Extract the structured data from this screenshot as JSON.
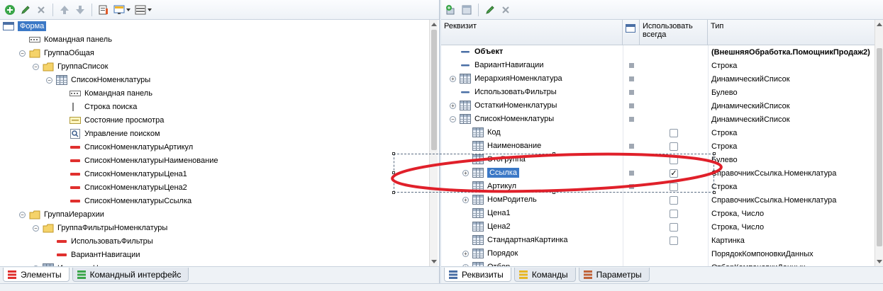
{
  "left": {
    "tree": [
      {
        "label": "Форма",
        "icon": "form-icon",
        "level": 0,
        "expander": "",
        "selected": true
      },
      {
        "label": "Командная панель",
        "icon": "command-panel-icon",
        "level": 1,
        "expander": ""
      },
      {
        "label": "ГруппаОбщая",
        "icon": "folder-icon",
        "level": 1,
        "expander": "−"
      },
      {
        "label": "ГруппаСписок",
        "icon": "folder-icon",
        "level": 2,
        "expander": "−"
      },
      {
        "label": "СписокНоменклатуры",
        "icon": "table-icon",
        "level": 3,
        "expander": "−"
      },
      {
        "label": "Командная панель",
        "icon": "command-panel-icon",
        "level": 4,
        "expander": ""
      },
      {
        "label": "Строка поиска",
        "icon": "search-string-icon",
        "level": 4,
        "expander": ""
      },
      {
        "label": "Состояние просмотра",
        "icon": "view-state-icon",
        "level": 4,
        "expander": ""
      },
      {
        "label": "Управление поиском",
        "icon": "search-icon",
        "level": 4,
        "expander": ""
      },
      {
        "label": "СписокНоменклатурыАртикул",
        "icon": "field-icon",
        "level": 4,
        "expander": ""
      },
      {
        "label": "СписокНоменклатурыНаименование",
        "icon": "field-icon",
        "level": 4,
        "expander": ""
      },
      {
        "label": "СписокНоменклатурыЦена1",
        "icon": "field-icon",
        "level": 4,
        "expander": ""
      },
      {
        "label": "СписокНоменклатурыЦена2",
        "icon": "field-icon",
        "level": 4,
        "expander": ""
      },
      {
        "label": "СписокНоменклатурыСсылка",
        "icon": "field-icon",
        "level": 4,
        "expander": ""
      },
      {
        "label": "ГруппаИерархии",
        "icon": "folder-icon",
        "level": 1,
        "expander": "−"
      },
      {
        "label": "ГруппаФильтрыНоменклатуры",
        "icon": "folder-icon",
        "level": 2,
        "expander": "−"
      },
      {
        "label": "ИспользоватьФильтры",
        "icon": "field-icon",
        "level": 3,
        "expander": ""
      },
      {
        "label": "ВариантНавигации",
        "icon": "field-icon",
        "level": 3,
        "expander": ""
      },
      {
        "label": "ИерархияНоменклатуры",
        "icon": "table-icon",
        "level": 2,
        "expander": "−"
      }
    ],
    "tabs": [
      {
        "label": "Элементы",
        "active": true,
        "icon": "elements-tab-icon"
      },
      {
        "label": "Командный интерфейс",
        "active": false,
        "icon": "command-interface-tab-icon"
      }
    ]
  },
  "right": {
    "columns": {
      "requisite": "Реквизит",
      "use_always": "Использовать всегда",
      "type": "Тип"
    },
    "rows": [
      {
        "name": "Объект",
        "level": 0,
        "expander": "",
        "icon": "object-icon",
        "bold": true,
        "marker": false,
        "checkbox": null,
        "type": "(ВнешняяОбработка.ПомощникПродаж2)"
      },
      {
        "name": "ВариантНавигации",
        "level": 0,
        "expander": "",
        "icon": "attribute-icon",
        "marker": true,
        "checkbox": null,
        "type": "Строка"
      },
      {
        "name": "ИерархияНоменклатура",
        "level": 0,
        "expander": "+",
        "icon": "table-icon",
        "marker": true,
        "checkbox": null,
        "type": "ДинамическийСписок"
      },
      {
        "name": "ИспользоватьФильтры",
        "level": 0,
        "expander": "",
        "icon": "attribute-icon",
        "marker": true,
        "checkbox": null,
        "type": "Булево"
      },
      {
        "name": "ОстаткиНоменклатуры",
        "level": 0,
        "expander": "+",
        "icon": "table-icon",
        "marker": true,
        "checkbox": null,
        "type": "ДинамическийСписок"
      },
      {
        "name": "СписокНоменклатуры",
        "level": 0,
        "expander": "−",
        "icon": "table-icon",
        "marker": true,
        "checkbox": null,
        "type": "ДинамическийСписок"
      },
      {
        "name": "Код",
        "level": 1,
        "expander": "",
        "icon": "table-icon",
        "marker": false,
        "checkbox": false,
        "type": "Строка"
      },
      {
        "name": "Наименование",
        "level": 1,
        "expander": "",
        "icon": "table-icon",
        "marker": true,
        "checkbox": false,
        "type": "Строка"
      },
      {
        "name": "ЭтоГруппа",
        "level": 1,
        "expander": "",
        "icon": "table-icon",
        "marker": false,
        "checkbox": false,
        "type": "Булево"
      },
      {
        "name": "Ссылка",
        "level": 1,
        "expander": "+",
        "icon": "table-icon",
        "marker": true,
        "checkbox": true,
        "type": "СправочникСсылка.Номенклатура",
        "selected": true
      },
      {
        "name": "Артикул",
        "level": 1,
        "expander": "",
        "icon": "table-icon",
        "marker": true,
        "checkbox": false,
        "type": "Строка"
      },
      {
        "name": "НомРодитель",
        "level": 1,
        "expander": "+",
        "icon": "table-icon",
        "marker": false,
        "checkbox": false,
        "type": "СправочникСсылка.Номенклатура"
      },
      {
        "name": "Цена1",
        "level": 1,
        "expander": "",
        "icon": "table-icon",
        "marker": false,
        "checkbox": false,
        "type": "Строка, Число"
      },
      {
        "name": "Цена2",
        "level": 1,
        "expander": "",
        "icon": "table-icon",
        "marker": false,
        "checkbox": false,
        "type": "Строка, Число"
      },
      {
        "name": "СтандартнаяКартинка",
        "level": 1,
        "expander": "",
        "icon": "table-icon",
        "marker": false,
        "checkbox": false,
        "type": "Картинка"
      },
      {
        "name": "Порядок",
        "level": 1,
        "expander": "+",
        "icon": "table-icon",
        "marker": false,
        "checkbox": null,
        "type": "ПорядокКомпоновкиДанных"
      },
      {
        "name": "Отбор",
        "level": 1,
        "expander": "+",
        "icon": "table-icon",
        "marker": false,
        "checkbox": null,
        "type": "ОтборКомпоновкиДанных"
      }
    ],
    "tabs": [
      {
        "label": "Реквизиты",
        "active": true,
        "icon": "requisites-tab-icon"
      },
      {
        "label": "Команды",
        "active": false,
        "icon": "commands-tab-icon"
      },
      {
        "label": "Параметры",
        "active": false,
        "icon": "parameters-tab-icon"
      }
    ]
  },
  "colors": {
    "accent": "#3b78c6",
    "annotation_ellipse": "#e0202a"
  }
}
